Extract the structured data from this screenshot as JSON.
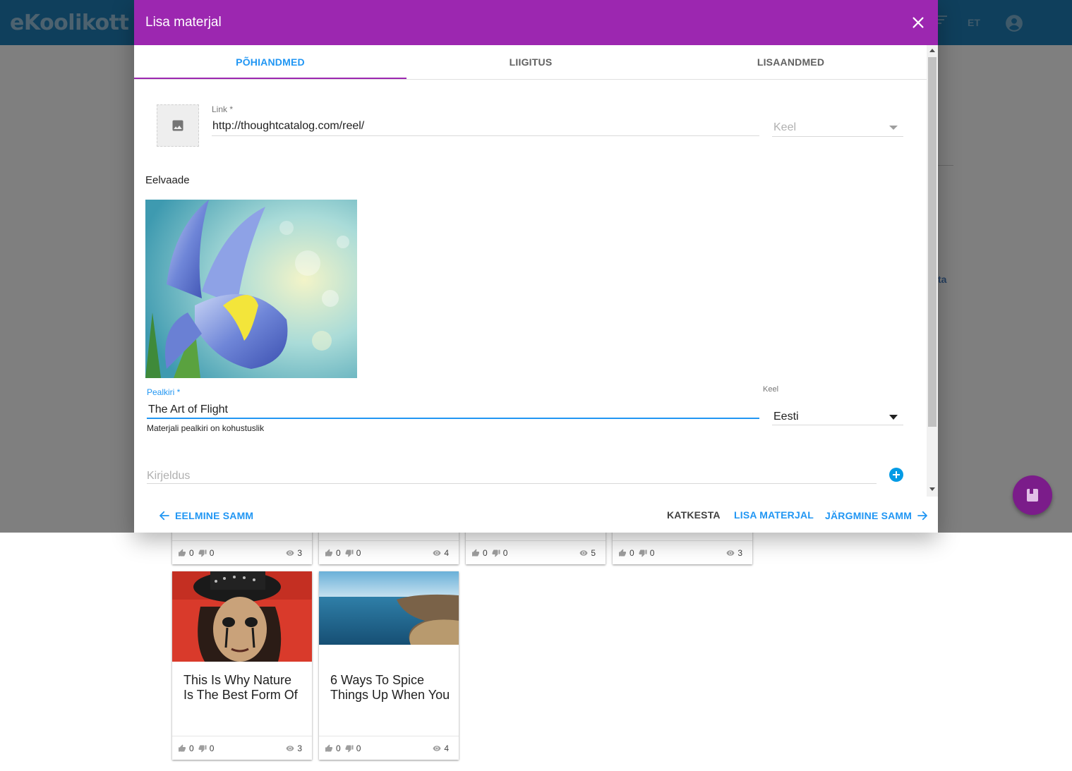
{
  "app": {
    "logo_text": "eKoolikott",
    "lang_button": "ET"
  },
  "background": {
    "side_link": "ta",
    "cards_top_row": [
      {
        "likes": "0",
        "dislikes": "0",
        "views": "3"
      },
      {
        "likes": "0",
        "dislikes": "0",
        "views": "4"
      },
      {
        "likes": "0",
        "dislikes": "0",
        "views": "5"
      },
      {
        "likes": "0",
        "dislikes": "0",
        "views": "3"
      }
    ],
    "cards": [
      {
        "title": "This Is Why Nature Is The Best Form Of",
        "likes": "0",
        "dislikes": "0",
        "views": "3"
      },
      {
        "title": "6 Ways To Spice Things Up When You",
        "likes": "0",
        "dislikes": "0",
        "views": "4"
      }
    ]
  },
  "dialog": {
    "title": "Lisa materjal",
    "tabs": [
      {
        "label": "PÕHIANDMED",
        "active": true
      },
      {
        "label": "LIIGITUS",
        "active": false
      },
      {
        "label": "LISAANDMED",
        "active": false
      }
    ],
    "link": {
      "label": "Link *",
      "value": "http://thoughtcatalog.com/reel/"
    },
    "language_top": {
      "placeholder": "Keel"
    },
    "preview_label": "Eelvaade",
    "title_field": {
      "label": "Pealkiri *",
      "value": "The Art of Flight",
      "help": "Materjali pealkiri on kohustuslik"
    },
    "language": {
      "label": "Keel",
      "value": "Eesti"
    },
    "description": {
      "placeholder": "Kirjeldus"
    },
    "actions": {
      "prev": "EELMINE SAMM",
      "cancel": "KATKESTA",
      "add": "LISA MATERJAL",
      "next": "JÄRGMINE SAMM"
    }
  },
  "colors": {
    "appbar": "#1f7fb8",
    "dialog_header": "#9c27b0",
    "accent": "#2196f3",
    "fab": "#7b1c8a"
  }
}
